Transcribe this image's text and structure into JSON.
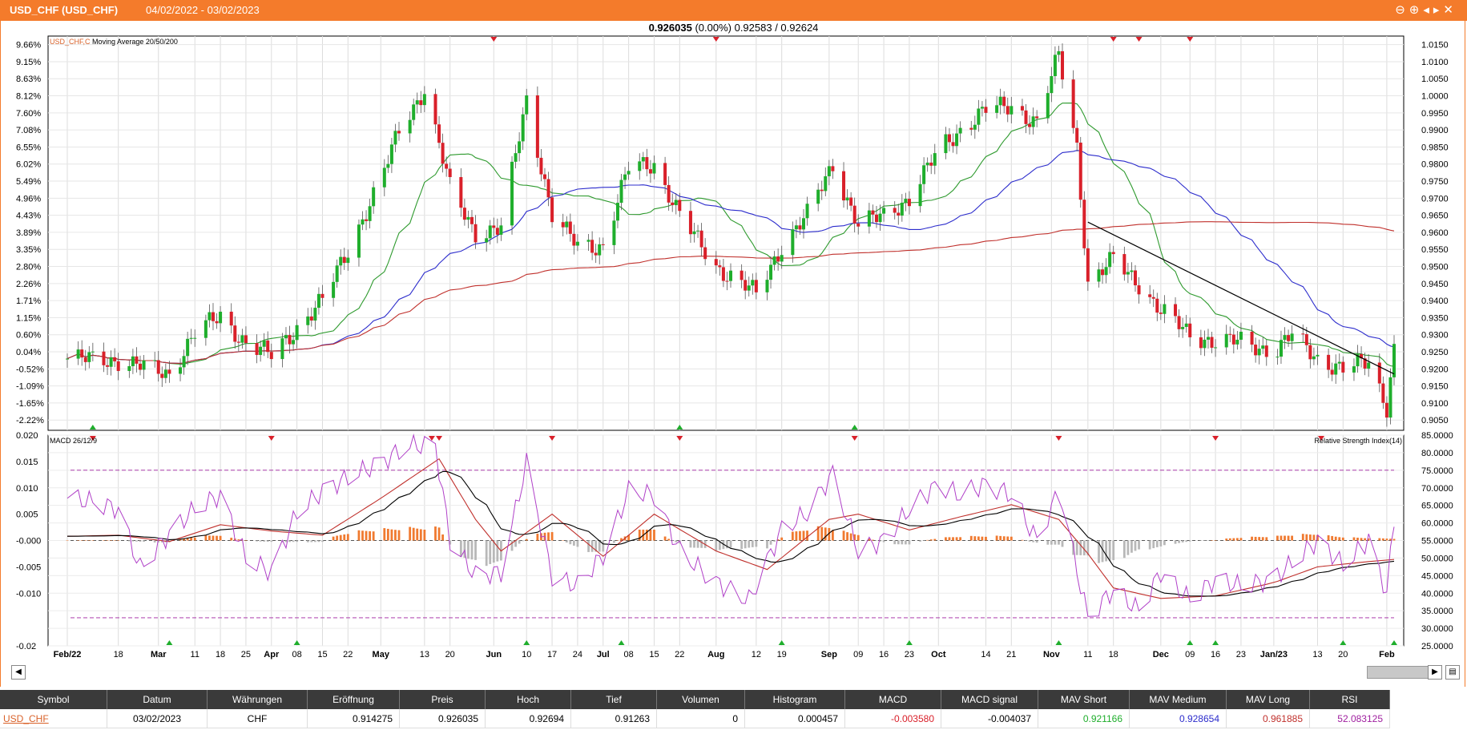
{
  "window": {
    "title": "USD_CHF (USD_CHF)",
    "date_range": "04/02/2022 - 03/02/2023",
    "controls": "⊖⊕◂▸✕"
  },
  "quote": {
    "price": "0.926035",
    "change": "(0.00%)",
    "bid_ask": "0.92583 / 0.92624"
  },
  "colors": {
    "accent": "#f47b2b",
    "bull": "#1fae2c",
    "bear": "#d9202a",
    "ma20": "#2e9a2e",
    "ma50": "#2c2ccc",
    "ma200": "#c0302c",
    "rsi": "#b040c8",
    "macd": "#c0302c",
    "signal": "#000000",
    "hist_pos": "#f07a30",
    "hist_neg": "#b8b8b8"
  },
  "chart_data": [
    {
      "type": "candlestick",
      "title": "USD_CHF,C",
      "subtitle": "Moving Average 20/50/200",
      "ylim": [
        0.902,
        1.0175
      ],
      "y_ticks_right": [
        "1.0150",
        "1.0100",
        "1.0050",
        "1.0000",
        "0.9950",
        "0.9900",
        "0.9850",
        "0.9800",
        "0.9750",
        "0.9700",
        "0.9650",
        "0.9600",
        "0.9550",
        "0.9500",
        "0.9450",
        "0.9400",
        "0.9350",
        "0.9300",
        "0.9250",
        "0.9200",
        "0.9150",
        "0.9100",
        "0.9050"
      ],
      "y_ticks_left": [
        "9.66%",
        "9.15%",
        "8.63%",
        "8.12%",
        "7.60%",
        "7.08%",
        "6.55%",
        "6.02%",
        "5.49%",
        "4.96%",
        "4.43%",
        "3.89%",
        "3.35%",
        "2.80%",
        "2.26%",
        "1.71%",
        "1.15%",
        "0.60%",
        "0.04%",
        "-0.52%",
        "-1.09%",
        "-1.65%",
        "-2.22%"
      ],
      "x_labels": [
        "Feb/22",
        "18",
        "Mar",
        "11",
        "18",
        "25",
        "Apr",
        "08",
        "15",
        "22",
        "May",
        "13",
        "20",
        "Jun",
        "10",
        "17",
        "24",
        "Jul",
        "08",
        "15",
        "22",
        "Aug",
        "12",
        "19",
        "Sep",
        "09",
        "16",
        "23",
        "Oct",
        "14",
        "21",
        "Nov",
        "11",
        "18",
        "Dec",
        "09",
        "16",
        "23",
        "Jan/23",
        "13",
        "20",
        "Feb"
      ],
      "x_label_dates": [
        "2022-02-04",
        "2022-02-18",
        "2022-03-01",
        "2022-03-11",
        "2022-03-18",
        "2022-03-25",
        "2022-04-01",
        "2022-04-08",
        "2022-04-15",
        "2022-04-22",
        "2022-05-01",
        "2022-05-13",
        "2022-05-20",
        "2022-06-01",
        "2022-06-10",
        "2022-06-17",
        "2022-06-24",
        "2022-07-01",
        "2022-07-08",
        "2022-07-15",
        "2022-07-22",
        "2022-08-01",
        "2022-08-12",
        "2022-08-19",
        "2022-09-01",
        "2022-09-09",
        "2022-09-16",
        "2022-09-23",
        "2022-10-01",
        "2022-10-14",
        "2022-10-21",
        "2022-11-01",
        "2022-11-11",
        "2022-11-18",
        "2022-12-01",
        "2022-12-09",
        "2022-12-16",
        "2022-12-23",
        "2023-01-01",
        "2023-01-13",
        "2023-01-20",
        "2023-02-01"
      ],
      "close_anchors": [
        [
          "2022-02-04",
          0.923
        ],
        [
          "2022-02-18",
          0.9225
        ],
        [
          "2022-03-04",
          0.9185
        ],
        [
          "2022-03-11",
          0.9305
        ],
        [
          "2022-03-18",
          0.9355
        ],
        [
          "2022-03-25",
          0.9275
        ],
        [
          "2022-04-01",
          0.924
        ],
        [
          "2022-04-08",
          0.932
        ],
        [
          "2022-04-15",
          0.94
        ],
        [
          "2022-04-22",
          0.955
        ],
        [
          "2022-05-01",
          0.975
        ],
        [
          "2022-05-06",
          0.99
        ],
        [
          "2022-05-13",
          1.002
        ],
        [
          "2022-05-20",
          0.973
        ],
        [
          "2022-05-27",
          0.96
        ],
        [
          "2022-06-03",
          0.961
        ],
        [
          "2022-06-10",
          0.999
        ],
        [
          "2022-06-17",
          0.965
        ],
        [
          "2022-06-24",
          0.956
        ],
        [
          "2022-07-01",
          0.956
        ],
        [
          "2022-07-08",
          0.979
        ],
        [
          "2022-07-15",
          0.98
        ],
        [
          "2022-07-22",
          0.965
        ],
        [
          "2022-08-01",
          0.95
        ],
        [
          "2022-08-12",
          0.942
        ],
        [
          "2022-08-19",
          0.956
        ],
        [
          "2022-08-26",
          0.965
        ],
        [
          "2022-09-02",
          0.98
        ],
        [
          "2022-09-09",
          0.962
        ],
        [
          "2022-09-16",
          0.965
        ],
        [
          "2022-09-23",
          0.97
        ],
        [
          "2022-10-01",
          0.984
        ],
        [
          "2022-10-07",
          0.99
        ],
        [
          "2022-10-14",
          0.996
        ],
        [
          "2022-10-21",
          0.997
        ],
        [
          "2022-10-28",
          0.992
        ],
        [
          "2022-11-03",
          1.012
        ],
        [
          "2022-11-08",
          0.985
        ],
        [
          "2022-11-11",
          0.945
        ],
        [
          "2022-11-18",
          0.952
        ],
        [
          "2022-11-25",
          0.945
        ],
        [
          "2022-12-01",
          0.937
        ],
        [
          "2022-12-09",
          0.93
        ],
        [
          "2022-12-16",
          0.928
        ],
        [
          "2022-12-23",
          0.928
        ],
        [
          "2023-01-01",
          0.925
        ],
        [
          "2023-01-06",
          0.93
        ],
        [
          "2023-01-13",
          0.923
        ],
        [
          "2023-01-20",
          0.92
        ],
        [
          "2023-01-27",
          0.922
        ],
        [
          "2023-02-01",
          0.909
        ],
        [
          "2023-02-03",
          0.926
        ]
      ],
      "ma_periods": [
        20,
        50,
        200
      ],
      "trendline": [
        [
          "2022-11-11",
          0.963
        ],
        [
          "2023-02-03",
          0.9185
        ]
      ],
      "markers_top": [
        "2022-06-01",
        "2022-08-01",
        "2022-11-18",
        "2022-11-25",
        "2022-12-09"
      ],
      "markers_bottom": [
        "2022-02-11",
        "2022-07-22",
        "2022-09-08"
      ]
    },
    {
      "type": "macd_rsi",
      "title_left": "MACD 26/12/9",
      "title_right": "Relative Strength Index(14)",
      "ylim_left": [
        -0.02,
        0.02
      ],
      "y_ticks_left": [
        "0.020",
        "0.015",
        "0.010",
        "0.005",
        "-0.000",
        "-0.005",
        "-0.010",
        "-0.02"
      ],
      "ylim_right": [
        25,
        85
      ],
      "y_ticks_right": [
        "85.0000",
        "80.0000",
        "75.0000",
        "70.0000",
        "65.0000",
        "60.0000",
        "55.0000",
        "50.0000",
        "45.0000",
        "40.0000",
        "35.0000",
        "30.0000",
        "25.0000"
      ],
      "rsi_levels": [
        75,
        33
      ],
      "macd_anchors": [
        [
          "2022-02-04",
          0.0008
        ],
        [
          "2022-02-18",
          0.001
        ],
        [
          "2022-03-04",
          -0.0002
        ],
        [
          "2022-03-18",
          0.003
        ],
        [
          "2022-04-01",
          0.0018
        ],
        [
          "2022-04-15",
          0.001
        ],
        [
          "2022-05-01",
          0.008
        ],
        [
          "2022-05-17",
          0.0155
        ],
        [
          "2022-05-27",
          0.004
        ],
        [
          "2022-06-03",
          -0.002
        ],
        [
          "2022-06-17",
          0.005
        ],
        [
          "2022-07-01",
          -0.003
        ],
        [
          "2022-07-15",
          0.005
        ],
        [
          "2022-08-01",
          -0.002
        ],
        [
          "2022-08-15",
          -0.0055
        ],
        [
          "2022-09-01",
          0.004
        ],
        [
          "2022-09-09",
          0.005
        ],
        [
          "2022-09-23",
          0.002
        ],
        [
          "2022-10-07",
          0.0045
        ],
        [
          "2022-10-21",
          0.0068
        ],
        [
          "2022-11-03",
          0.004
        ],
        [
          "2022-11-11",
          -0.0025
        ],
        [
          "2022-11-18",
          -0.009
        ],
        [
          "2022-12-01",
          -0.011
        ],
        [
          "2022-12-16",
          -0.0105
        ],
        [
          "2023-01-01",
          -0.008
        ],
        [
          "2023-01-13",
          -0.005
        ],
        [
          "2023-01-27",
          -0.004
        ],
        [
          "2023-02-03",
          -0.0036
        ]
      ],
      "rsi_anchors": [
        [
          "2022-02-04",
          67
        ],
        [
          "2022-02-11",
          66
        ],
        [
          "2022-02-18",
          64
        ],
        [
          "2022-02-24",
          47
        ],
        [
          "2022-03-04",
          57
        ],
        [
          "2022-03-11",
          64
        ],
        [
          "2022-03-18",
          68
        ],
        [
          "2022-03-25",
          50
        ],
        [
          "2022-04-01",
          46
        ],
        [
          "2022-04-08",
          63
        ],
        [
          "2022-04-15",
          69
        ],
        [
          "2022-04-22",
          73
        ],
        [
          "2022-05-01",
          77
        ],
        [
          "2022-05-08",
          82
        ],
        [
          "2022-05-16",
          82
        ],
        [
          "2022-05-20",
          55
        ],
        [
          "2022-05-27",
          45
        ],
        [
          "2022-06-03",
          46
        ],
        [
          "2022-06-10",
          77
        ],
        [
          "2022-06-17",
          45
        ],
        [
          "2022-06-24",
          42
        ],
        [
          "2022-07-01",
          51
        ],
        [
          "2022-07-08",
          69
        ],
        [
          "2022-07-15",
          68
        ],
        [
          "2022-07-22",
          52
        ],
        [
          "2022-08-01",
          43
        ],
        [
          "2022-08-10",
          38
        ],
        [
          "2022-08-19",
          58
        ],
        [
          "2022-08-26",
          63
        ],
        [
          "2022-09-02",
          74
        ],
        [
          "2022-09-09",
          52
        ],
        [
          "2022-09-16",
          55
        ],
        [
          "2022-09-23",
          64
        ],
        [
          "2022-10-01",
          71
        ],
        [
          "2022-10-07",
          68
        ],
        [
          "2022-10-14",
          71
        ],
        [
          "2022-10-21",
          68
        ],
        [
          "2022-10-28",
          55
        ],
        [
          "2022-11-03",
          69
        ],
        [
          "2022-11-11",
          33
        ],
        [
          "2022-11-18",
          41
        ],
        [
          "2022-11-25",
          35
        ],
        [
          "2022-12-01",
          46
        ],
        [
          "2022-12-09",
          38
        ],
        [
          "2022-12-16",
          44
        ],
        [
          "2022-12-23",
          42
        ],
        [
          "2023-01-01",
          44
        ],
        [
          "2023-01-13",
          55
        ],
        [
          "2023-01-20",
          48
        ],
        [
          "2023-01-27",
          55
        ],
        [
          "2023-02-01",
          40
        ],
        [
          "2023-02-03",
          61
        ]
      ],
      "markers_top": [
        "2022-02-11",
        "2022-04-01",
        "2022-05-15",
        "2022-05-17",
        "2022-06-17",
        "2022-07-22",
        "2022-09-08",
        "2022-11-03",
        "2022-12-16",
        "2023-01-14"
      ],
      "markers_bottom": [
        "2022-03-04",
        "2022-04-08",
        "2022-06-10",
        "2022-07-06",
        "2022-08-19",
        "2022-09-23",
        "2022-11-03",
        "2022-12-09",
        "2022-12-16",
        "2023-01-20",
        "2023-02-03"
      ]
    }
  ],
  "table": {
    "headers": [
      "Symbol",
      "Datum",
      "Währungen",
      "Eröffnung",
      "Preis",
      "Hoch",
      "Tief",
      "Volumen",
      "Histogram",
      "MACD",
      "MACD signal",
      "MAV Short",
      "MAV Medium",
      "MAV Long",
      "RSI"
    ],
    "row": [
      "USD_CHF",
      "03/02/2023",
      "CHF",
      "0.914275",
      "0.926035",
      "0.92694",
      "0.91263",
      "0",
      "0.000457",
      "-0.003580",
      "-0.004037",
      "0.921166",
      "0.928654",
      "0.961885",
      "52.083125"
    ]
  }
}
